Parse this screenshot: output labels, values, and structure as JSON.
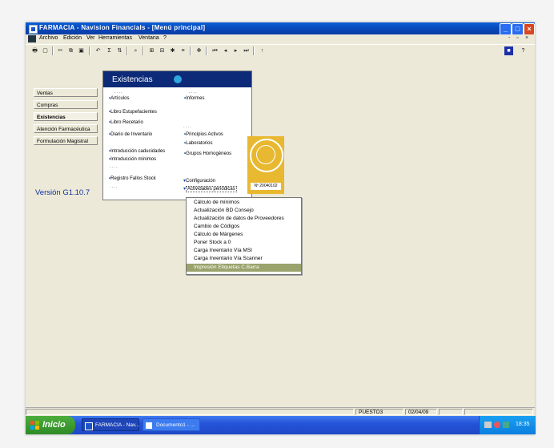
{
  "window": {
    "title": "FARMACIA - Navision Financials - [Menú principal]"
  },
  "menubar": {
    "items": [
      "Archivo",
      "Edición",
      "Ver",
      "Herramientas",
      "Ventana",
      "?"
    ]
  },
  "nav": {
    "items": [
      "Ventas",
      "Compras",
      "Existencias",
      "Atención Farmacéutica",
      "Formulación Magistral"
    ],
    "selected": "Existencias"
  },
  "version": "Versión G1.10.7",
  "panel": {
    "title": "Existencias",
    "left_items": [
      "Artículos",
      "Libro Estupefacientes",
      "Libro Recetario",
      "Diario de Inventario",
      "Introducción caducidades",
      "Introducción mínimos",
      "Registro Fallos Stock"
    ],
    "right_items": [
      "Informes",
      "Principios Activos",
      "Laboratorios",
      "Grupos Homogéneos",
      "Configuración",
      "Actividades periódicas"
    ],
    "dots": "...."
  },
  "seal": {
    "label": "Nº 20040102",
    "ring_text": "CERTIFICADO"
  },
  "dropdown": {
    "items": [
      "Cálculo de mínimos",
      "Actualización BD Consejo",
      "Actualización de datos de Proveedores",
      "Cambio de Códigos",
      "Cálculo de Márgenes",
      "Poner Stock a 0",
      "Carga Inventario Vía MSI",
      "Carga Inventario Vía Scanner",
      "Impresión Etiquetas C.Barra"
    ],
    "active_index": 8
  },
  "status": {
    "user": "PUESTO3",
    "date": "02/04/09"
  },
  "taskbar": {
    "start_label": "Inicio",
    "tasks": [
      "FARMACIA - Nav...",
      "Documento1 - ..."
    ],
    "clock": "18:35"
  },
  "colors": {
    "title_blue": "#0a5fd8",
    "panel_header": "#0c2a78",
    "accent_cyan": "#2da7dd",
    "seal": "#e8b830",
    "active_item": "#9aa36c",
    "version_text": "#1030a0"
  }
}
